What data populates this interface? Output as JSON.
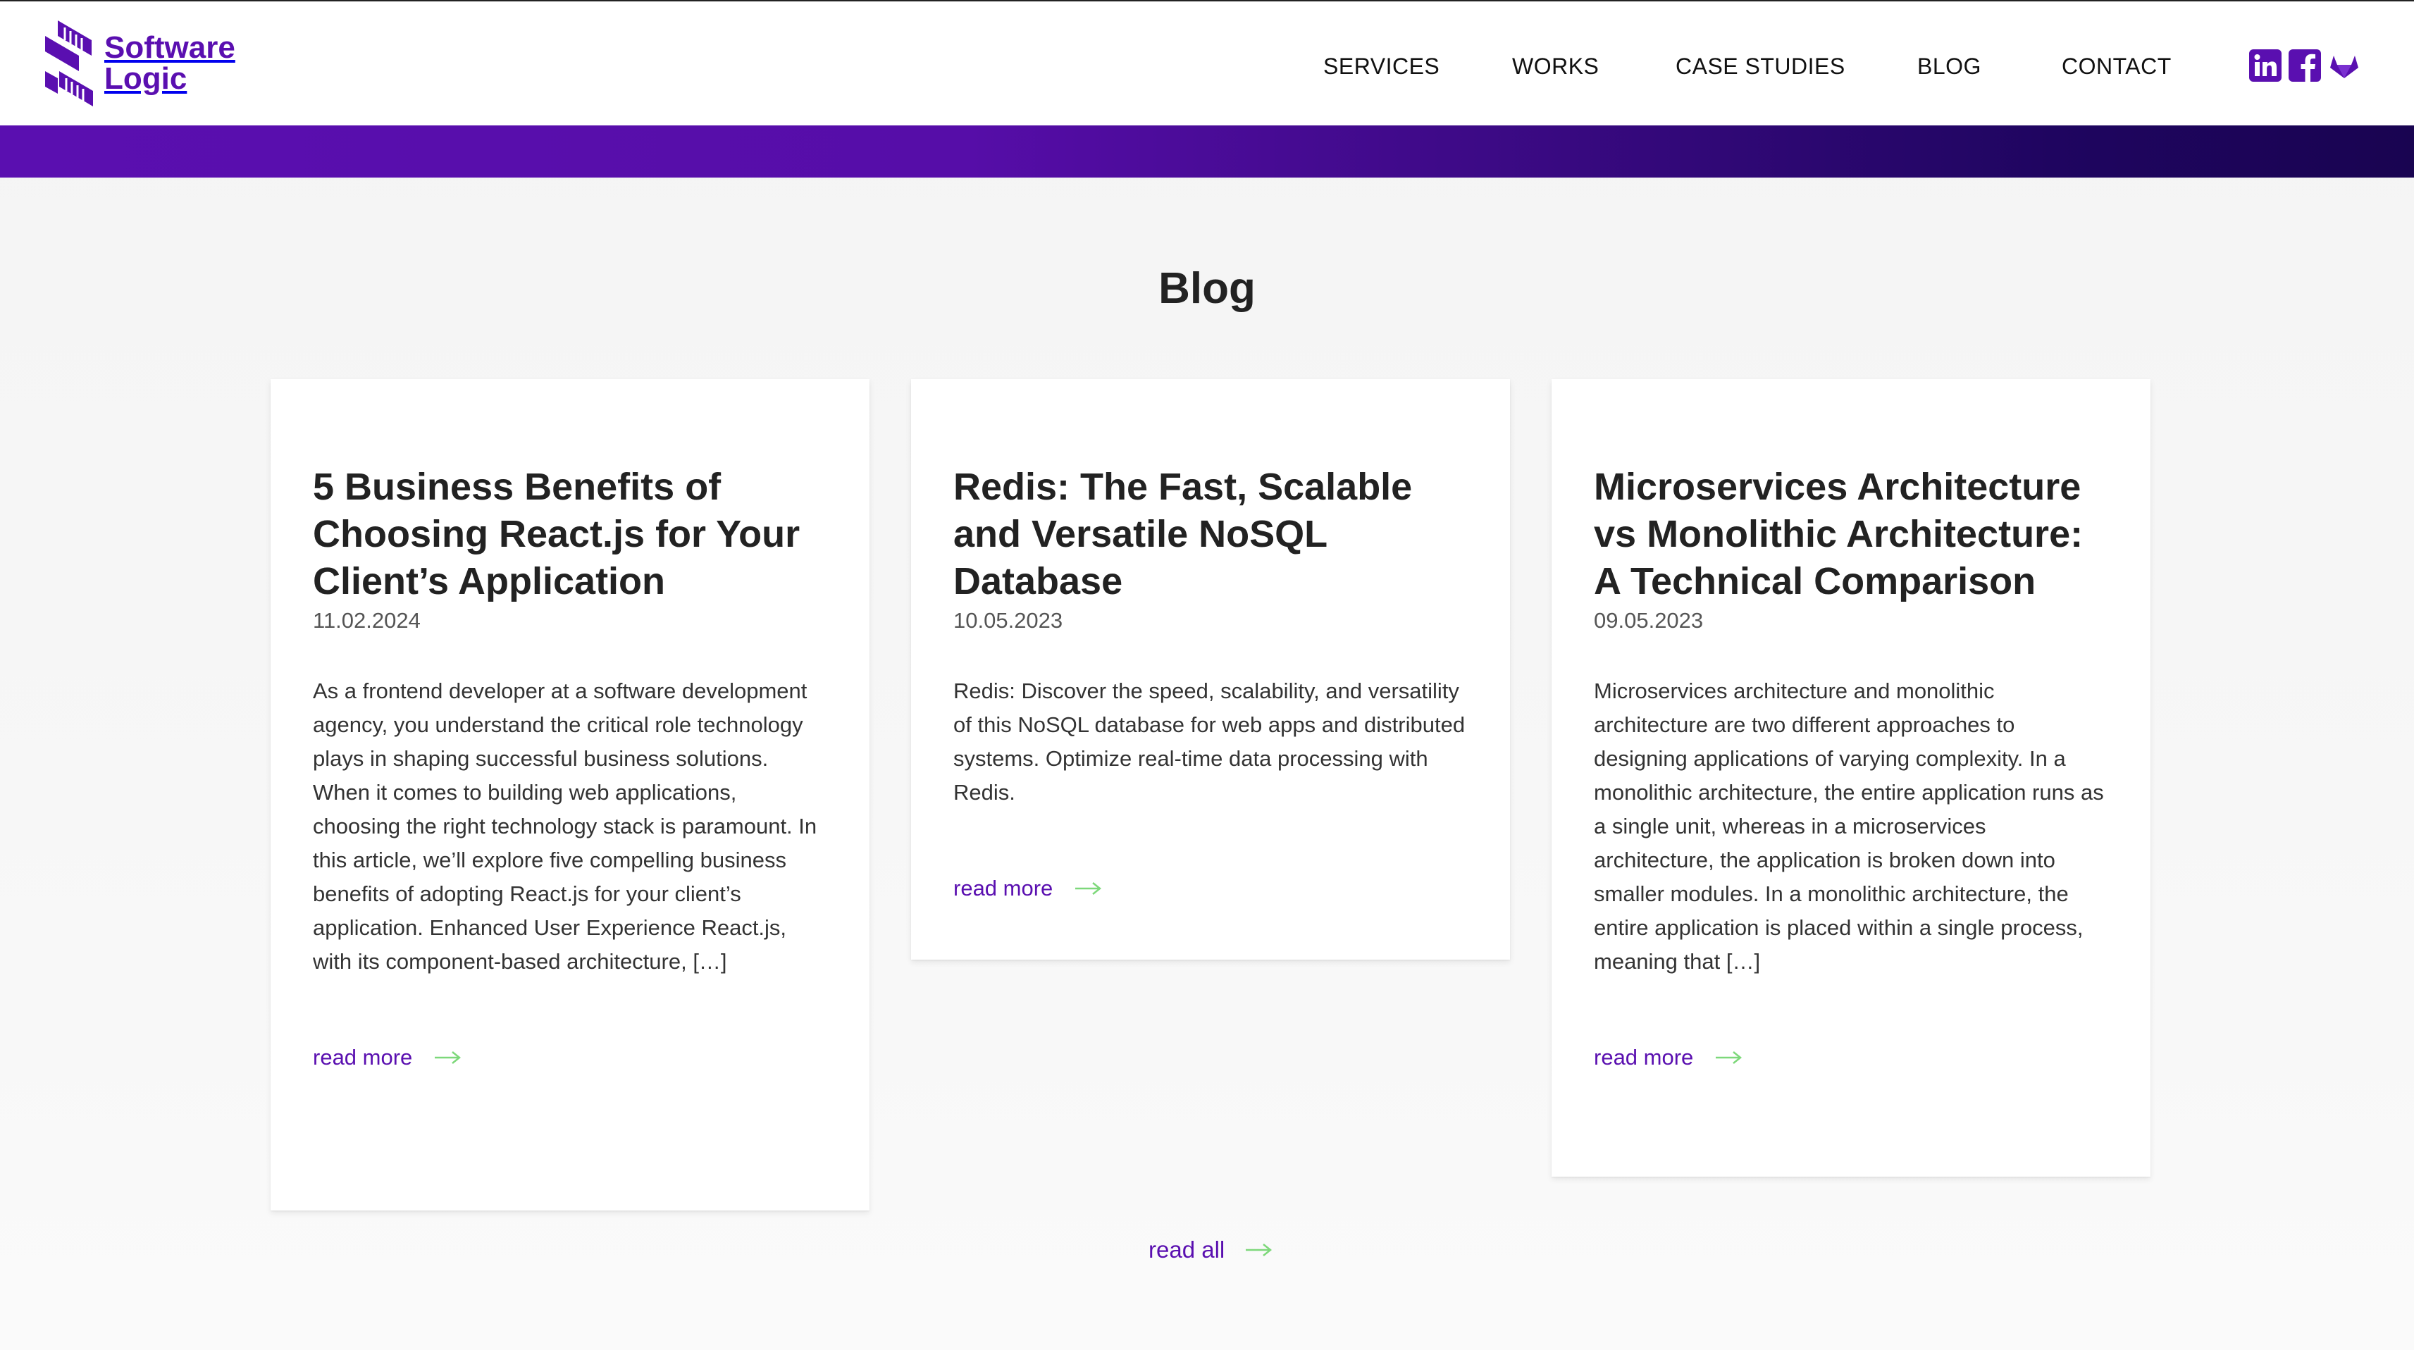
{
  "brand": {
    "line1": "Software",
    "line2": "Logic",
    "color": "#5a0fb0"
  },
  "nav": {
    "items": [
      {
        "label": "SERVICES"
      },
      {
        "label": "WORKS"
      },
      {
        "label": "CASE STUDIES"
      },
      {
        "label": "BLOG"
      },
      {
        "label": "CONTACT"
      }
    ]
  },
  "social": [
    {
      "icon": "linkedin-icon"
    },
    {
      "icon": "facebook-icon"
    },
    {
      "icon": "gitlab-icon"
    }
  ],
  "page": {
    "title": "Blog"
  },
  "posts": [
    {
      "title": "5 Business Benefits of Choosing React.js for Your Client’s Application",
      "date": "11.02.2024",
      "excerpt": "As a frontend developer at a software development agency, you understand the critical role technology plays in shaping successful business solutions. When it comes to building web applications, choosing the right technology stack is paramount. In this article, we’ll explore five compelling business benefits of adopting React.js for your client’s application. Enhanced User Experience React.js, with its component-based architecture, […]",
      "link": "read more"
    },
    {
      "title": "Redis: The Fast, Scalable and Versatile NoSQL Database",
      "date": "10.05.2023",
      "excerpt": "Redis: Discover the speed, scalability, and versatility of this NoSQL database for web apps and distributed systems. Optimize real-time data processing with Redis.",
      "link": "read more"
    },
    {
      "title": "Microservices Architecture vs Monolithic Architecture: A Technical Comparison",
      "date": "09.05.2023",
      "excerpt": "Microservices architecture and monolithic architecture are two different approaches to designing applications of varying complexity. In a monolithic architecture, the entire application runs as a single unit, whereas in a microservices architecture, the application is broken down into smaller modules. In a monolithic architecture, the entire application is placed within a single process, meaning that […]",
      "link": "read more"
    }
  ],
  "read_all": "read all",
  "colors": {
    "accent": "#5a0fb0",
    "arrow": "#7dd87a",
    "band_start": "#5a0fb0",
    "band_end": "#190451"
  }
}
